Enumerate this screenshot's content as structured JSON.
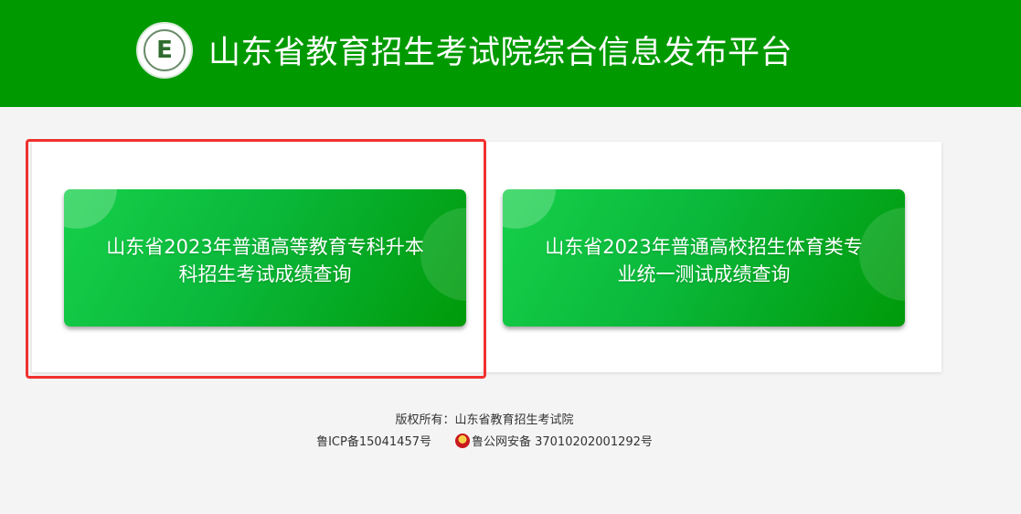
{
  "header": {
    "title": "山东省教育招生考试院综合信息发布平台",
    "logo_letter": "E",
    "background_color": "#009a00"
  },
  "cards": [
    {
      "line1": "山东省2023年普通高等教育专科升本",
      "line2": "科招生考试成绩查询",
      "highlighted": true
    },
    {
      "line1": "山东省2023年普通高校招生体育类专",
      "line2": "业统一测试成绩查询",
      "highlighted": false
    }
  ],
  "colors": {
    "card_gradient_start": "#16d04a",
    "card_gradient_end": "#009a0a",
    "highlight_border": "#f0312e",
    "page_background": "#f4f4f4"
  },
  "footer": {
    "copyright": "版权所有：山东省教育招生考试院",
    "icp": "鲁ICP备15041457号",
    "police_icon": "police-badge-icon",
    "police_record": "鲁公网安备 37010202001292号"
  }
}
